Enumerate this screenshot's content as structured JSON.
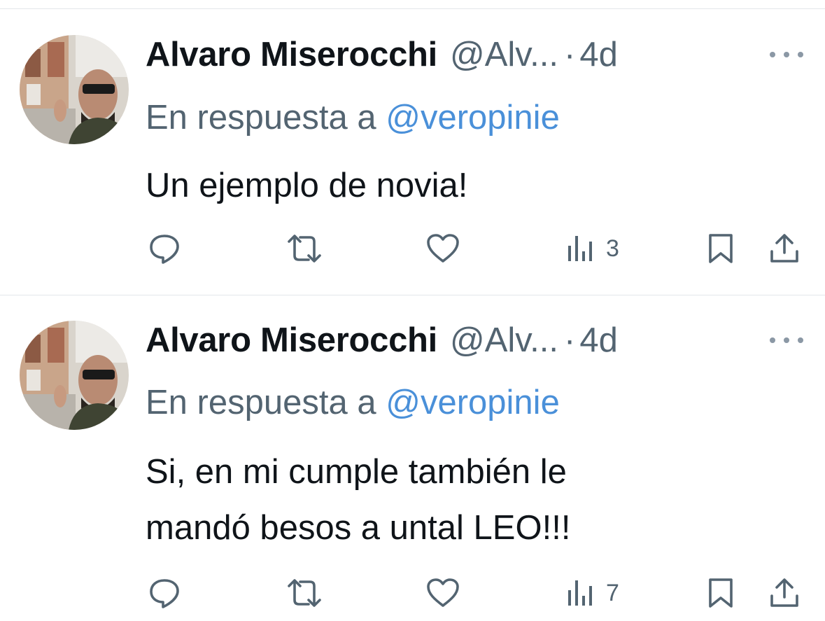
{
  "tweets": [
    {
      "author_name": "Alvaro Miserocchi",
      "author_handle": "@Alv...",
      "separator": "·",
      "time": "4d",
      "reply_prefix": "En respuesta a",
      "reply_mention": "@veropinie",
      "text": "Un ejemplo de novia!",
      "actions": {
        "reply": "",
        "repost": "",
        "like": "",
        "views": "3"
      }
    },
    {
      "author_name": "Alvaro Miserocchi",
      "author_handle": "@Alv...",
      "separator": "·",
      "time": "4d",
      "reply_prefix": "En respuesta a",
      "reply_mention": "@veropinie",
      "text": "Si, en mi cumple también le\nmandó besos a untal LEO!!!",
      "actions": {
        "reply": "",
        "repost": "",
        "like": "",
        "views": "7"
      }
    }
  ],
  "icons": {
    "reply": "reply-icon",
    "repost": "repost-icon",
    "like": "heart-icon",
    "views": "views-icon",
    "bookmark": "bookmark-icon",
    "share": "share-icon",
    "more": "more-icon"
  },
  "colors": {
    "text": "#0f1419",
    "secondary": "#536471",
    "mention": "#4a90d9",
    "divider": "#e3e6ea"
  }
}
